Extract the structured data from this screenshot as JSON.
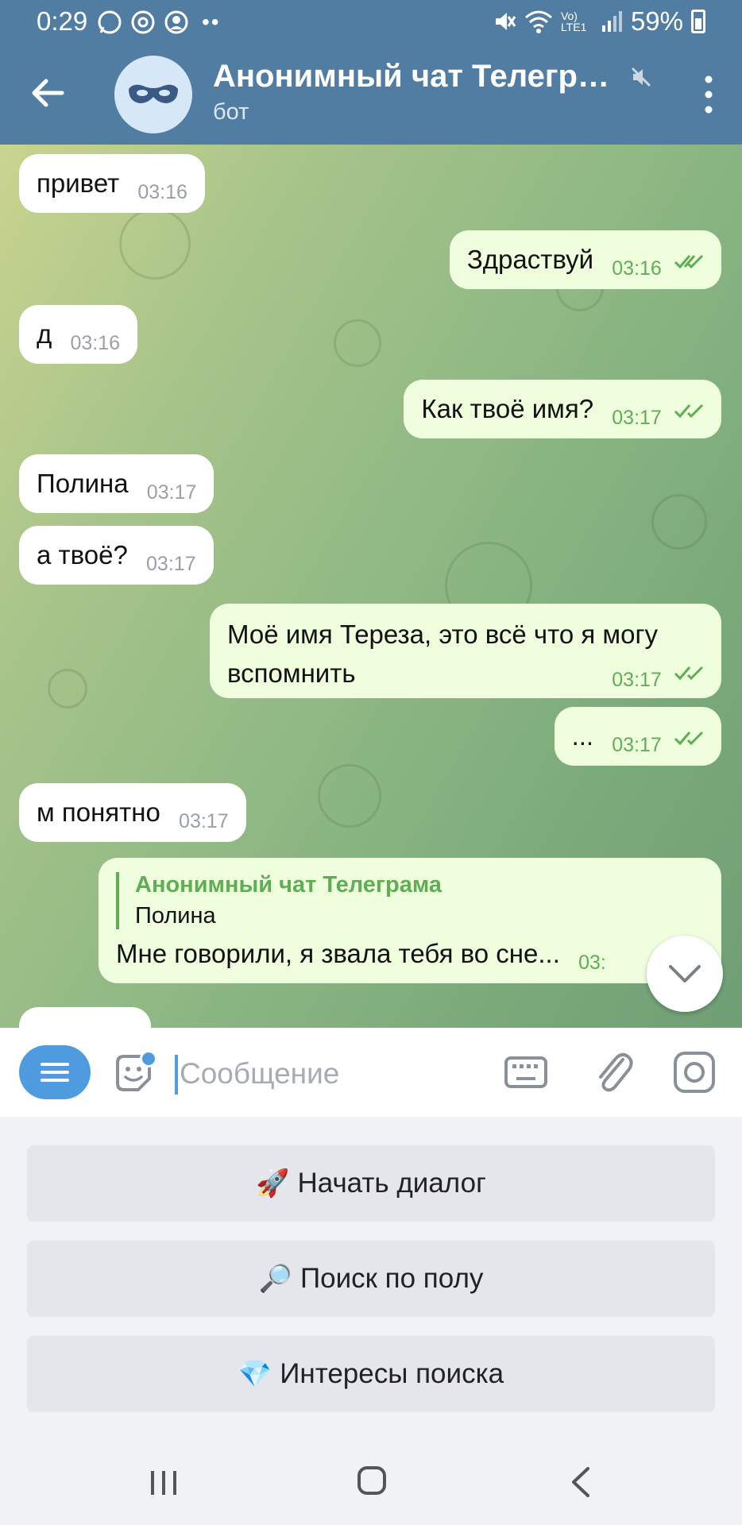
{
  "status_bar": {
    "time": "0:29",
    "battery": "59%",
    "network": "Vo) LTE1"
  },
  "header": {
    "title": "Анонимный чат Телегра…",
    "subtitle": "бот"
  },
  "messages": [
    {
      "dir": "in",
      "text": "привет",
      "time": "03:16"
    },
    {
      "dir": "out",
      "text": "Здраствуй",
      "time": "03:16"
    },
    {
      "dir": "in",
      "text": "д",
      "time": "03:16"
    },
    {
      "dir": "out",
      "text": "Как твоё имя?",
      "time": "03:17"
    },
    {
      "dir": "in",
      "text": "Полина",
      "time": "03:17"
    },
    {
      "dir": "in",
      "text": "а твоё?",
      "time": "03:17"
    },
    {
      "dir": "out",
      "text_line1": "Моё имя Тереза, это всё что я могу",
      "text_line2": "вспомнить",
      "time": "03:17"
    },
    {
      "dir": "out",
      "text": "...",
      "time": "03:17"
    },
    {
      "dir": "in",
      "text": "м понятно",
      "time": "03:17"
    },
    {
      "dir": "out",
      "reply_name": "Анонимный чат Телеграма",
      "reply_text": "Полина",
      "text": "Мне говорили, я звала тебя во сне...",
      "time": "03:"
    }
  ],
  "input": {
    "placeholder": "Сообщение"
  },
  "bot_keyboard": [
    {
      "emoji": "🚀",
      "label": "Начать диалог"
    },
    {
      "emoji": "🔎",
      "label": "Поиск по полу"
    },
    {
      "emoji": "💎",
      "label": "Интересы поиска"
    }
  ],
  "colors": {
    "header": "#527da3",
    "outgoing_bubble": "#effedd",
    "incoming_bubble": "#ffffff",
    "accent_green": "#5fae54",
    "accent_blue": "#4f9be0"
  }
}
